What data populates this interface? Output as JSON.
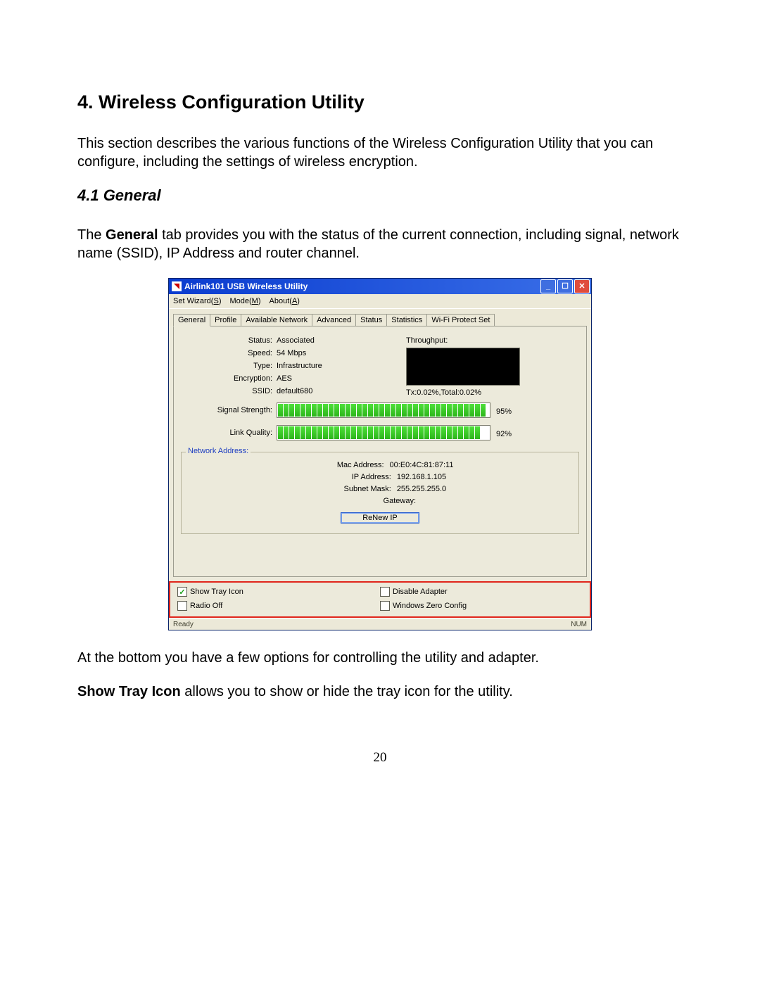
{
  "doc": {
    "h1": "4. Wireless Configuration Utility",
    "intro": "This section describes the various functions of the Wireless Configuration Utility that you can configure, including the settings of wireless encryption.",
    "h2": "4.1 General",
    "desc_pre": "The ",
    "desc_bold1": "General",
    "desc_post": " tab provides you with the status of the current connection, including signal, network name (SSID), IP Address and router channel.",
    "after1": "At the bottom you have a few options for controlling the utility and adapter.",
    "after2_bold": "Show Tray Icon",
    "after2_rest": " allows you to show or hide the tray icon for the utility.",
    "page_num": "20"
  },
  "app": {
    "title": "Airlink101 USB Wireless Utility",
    "menu": {
      "wizard": "Set Wizard(",
      "wizard_u": "S",
      "wizard2": ")",
      "mode": "Mode(",
      "mode_u": "M",
      "mode2": ")",
      "about": "About(",
      "about_u": "A",
      "about2": ")"
    },
    "tabs": [
      "General",
      "Profile",
      "Available Network",
      "Advanced",
      "Status",
      "Statistics",
      "Wi-Fi Protect Set"
    ],
    "status": {
      "label": "Status:",
      "val": "Associated"
    },
    "speed": {
      "label": "Speed:",
      "val": "54 Mbps"
    },
    "type": {
      "label": "Type:",
      "val": "Infrastructure"
    },
    "encryption": {
      "label": "Encryption:",
      "val": "AES"
    },
    "ssid": {
      "label": "SSID:",
      "val": "default680"
    },
    "throughput_label": "Throughput:",
    "throughput_text": "Tx:0.02%,Total:0.02%",
    "signal": {
      "label": "Signal Strength:",
      "pct": "95%",
      "segs": 37
    },
    "link": {
      "label": "Link Quality:",
      "pct": "92%",
      "segs": 36
    },
    "na_legend": "Network Address:",
    "mac": {
      "label": "Mac Address:",
      "val": "00:E0:4C:81:87:11"
    },
    "ip": {
      "label": "IP Address:",
      "val": "192.168.1.105"
    },
    "mask": {
      "label": "Subnet Mask:",
      "val": "255.255.255.0"
    },
    "gw": {
      "label": "Gateway:",
      "val": ""
    },
    "renew": "ReNew IP",
    "opts": {
      "tray": "Show Tray Icon",
      "radio": "Radio Off",
      "disable": "Disable Adapter",
      "zero": "Windows Zero Config"
    },
    "status_ready": "Ready",
    "status_num": "NUM"
  }
}
